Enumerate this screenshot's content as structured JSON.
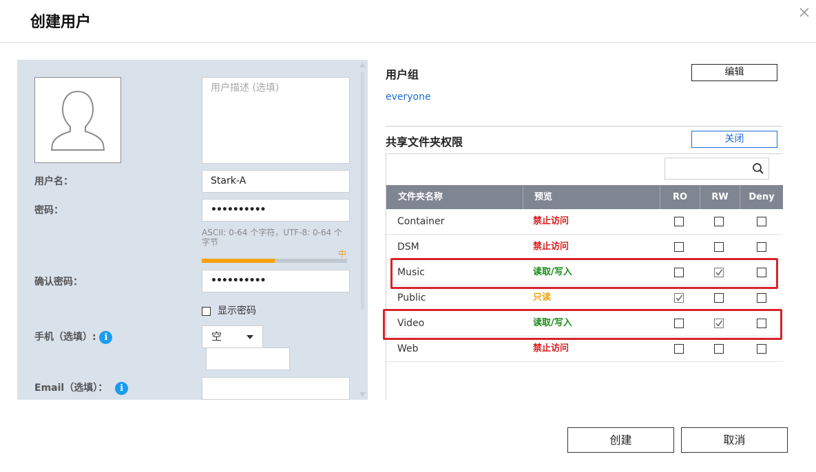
{
  "dialog": {
    "title": "创建用户"
  },
  "left": {
    "desc_placeholder": "用户描述 (选填)",
    "username_label": "用户名：",
    "username_value": "Stark-A",
    "password_label": "密码：",
    "password_value": "••••••••••",
    "password_hint": "ASCII: 0-64 个字符，UTF-8: 0-64 个字节",
    "strength_label": "中",
    "strength_level": 0.5,
    "confirm_label": "确认密码：",
    "confirm_value": "••••••••••",
    "show_password_label": "显示密码",
    "phone_label": "手机（选填）:",
    "phone_country": "空",
    "email_label": "Email（选填）：",
    "info_glyph": "i"
  },
  "right": {
    "group_title": "用户组",
    "edit_label": "编辑",
    "group_name": "everyone",
    "share_title": "共享文件夹权限",
    "close_label": "关闭",
    "columns": [
      "文件夹名称",
      "预览",
      "RO",
      "RW",
      "Deny"
    ],
    "rows": [
      {
        "name": "Container",
        "perm": "禁止访问",
        "perm_kind": "deny",
        "ro": false,
        "rw": false,
        "deny": false,
        "highlight": false
      },
      {
        "name": "DSM",
        "perm": "禁止访问",
        "perm_kind": "deny",
        "ro": false,
        "rw": false,
        "deny": false,
        "highlight": false
      },
      {
        "name": "Music",
        "perm": "读取/写入",
        "perm_kind": "rw",
        "ro": false,
        "rw": true,
        "deny": false,
        "highlight": true
      },
      {
        "name": "Public",
        "perm": "只读",
        "perm_kind": "ro",
        "ro": true,
        "rw": false,
        "deny": false,
        "highlight": false
      },
      {
        "name": "Video",
        "perm": "读取/写入",
        "perm_kind": "rw",
        "ro": false,
        "rw": true,
        "deny": false,
        "highlight": true
      },
      {
        "name": "Web",
        "perm": "禁止访问",
        "perm_kind": "deny",
        "ro": false,
        "rw": false,
        "deny": false,
        "highlight": false
      }
    ]
  },
  "footer": {
    "create_label": "创建",
    "cancel_label": "取消"
  },
  "colors": {
    "panel_bg": "#d9e1eb",
    "header_bg": "#7f8591",
    "link": "#1a6ad6",
    "deny": "#d81b1b",
    "rw": "#1a8a1a",
    "ro": "#f0a30a",
    "strength": "#f5a10d",
    "highlight": "#d8232a"
  },
  "icons": [
    "close-icon",
    "user-silhouette-icon",
    "info-icon",
    "search-icon",
    "chevron-down-icon"
  ]
}
